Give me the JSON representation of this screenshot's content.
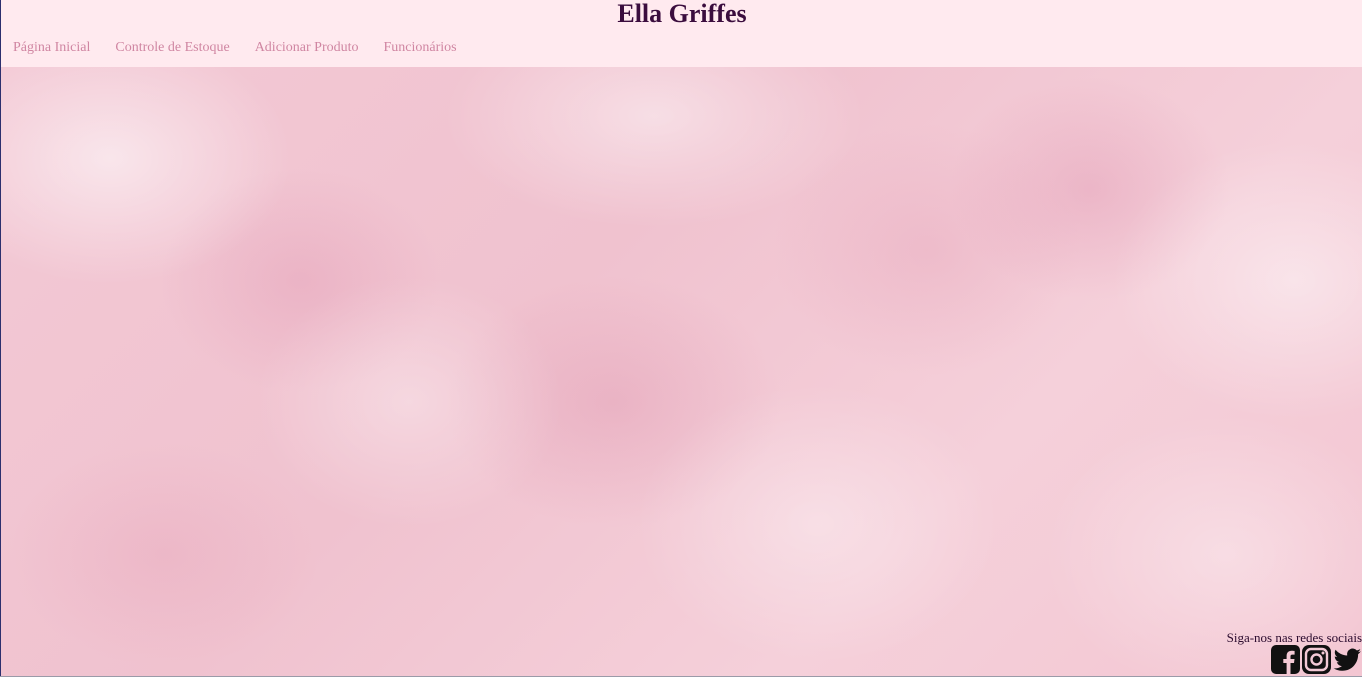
{
  "header": {
    "title": "Ella Griffes",
    "nav": [
      {
        "label": "Página Inicial"
      },
      {
        "label": "Controle de Estoque"
      },
      {
        "label": "Adicionar Produto"
      },
      {
        "label": "Funcionários"
      }
    ]
  },
  "footer": {
    "text": "Siga-nos nas redes sociais",
    "social": [
      {
        "icon": "facebook-icon"
      },
      {
        "icon": "instagram-icon"
      },
      {
        "icon": "twitter-icon"
      }
    ]
  },
  "colors": {
    "title": "#3b0d3e",
    "nav_link": "#d086a2",
    "header_bg": "#ffeaef",
    "background": "#f3c9d5"
  }
}
